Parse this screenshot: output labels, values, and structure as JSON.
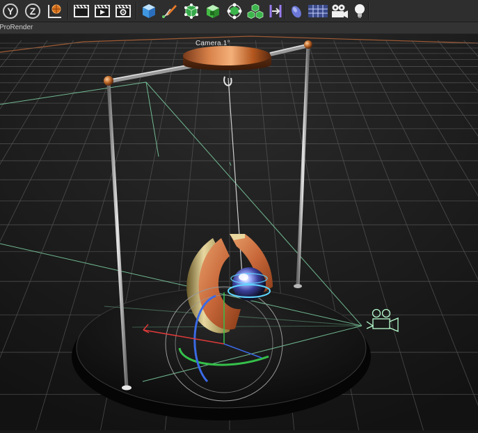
{
  "toolbar": {
    "axis_buttons": [
      {
        "label": "Y",
        "icon": "axis-y-lock-icon"
      },
      {
        "label": "Z",
        "icon": "axis-z-lock-icon"
      },
      {
        "label": "",
        "icon": "coordinate-system-icon"
      }
    ],
    "render_buttons": [
      "render-region-icon",
      "render-view-icon",
      "render-settings-icon"
    ],
    "object_buttons": [
      "cube-icon",
      "pen-spline-icon",
      "subdivision-icon",
      "extrude-icon",
      "cloner-icon",
      "array-icon",
      "deformer-icon",
      "floor-icon",
      "sky-grid-icon",
      "camera-icon",
      "light-icon"
    ]
  },
  "menubar": {
    "label": "ProRender"
  },
  "viewport": {
    "camera_label": "Camera.1",
    "camera_suffix": "°"
  },
  "colors": {
    "accent_orange": "#e87a2a",
    "grid_line": "#5c5c5c",
    "frustum_green": "#7fd4a6",
    "axis_x": "#e03a3a",
    "axis_y": "#35c04a",
    "axis_z": "#3a6ae6",
    "copper": "#c26a3c"
  }
}
